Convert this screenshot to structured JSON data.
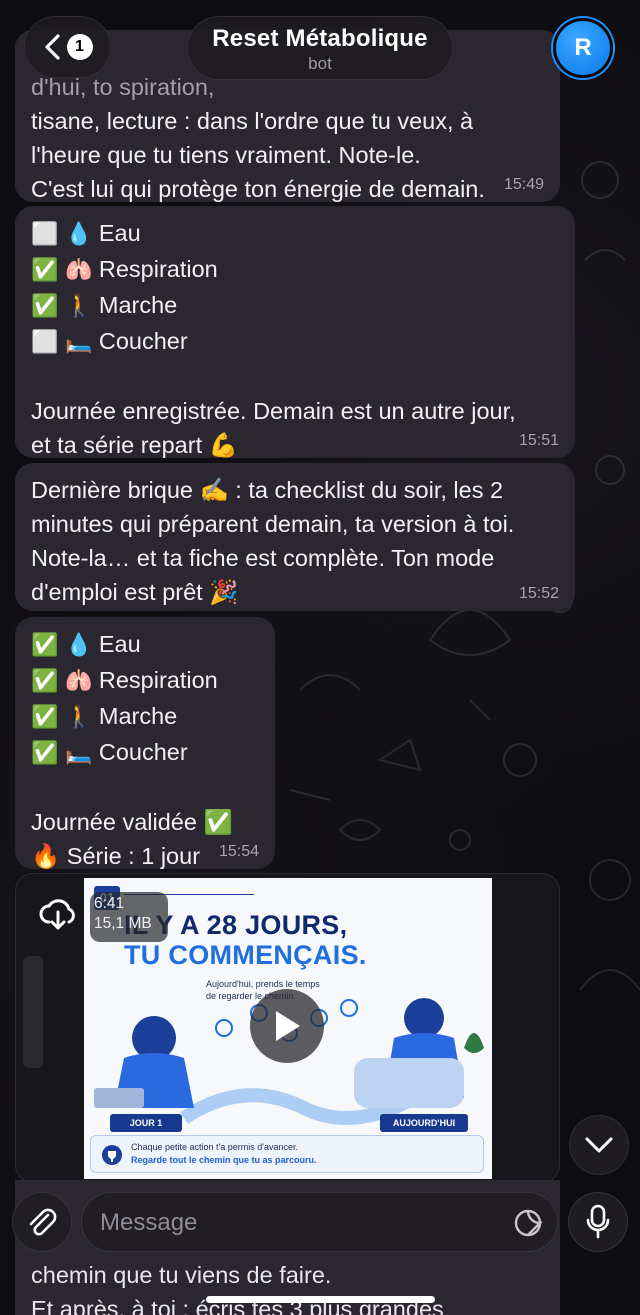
{
  "header": {
    "back_badge": "1",
    "title": "Reset Métabolique",
    "subtitle": "bot",
    "avatar_letter": "R"
  },
  "messages": {
    "m1": {
      "lines": [
        "d'hui, to                 spiration,",
        "tisane, lecture : dans l'ordre que tu veux, à",
        "l'heure que tu tiens vraiment. Note-le.",
        "C'est lui qui protège ton énergie de demain."
      ],
      "time": "15:49"
    },
    "m2": {
      "checklist": [
        {
          "check": "⬜",
          "icon": "💧",
          "label": "Eau"
        },
        {
          "check": "✅",
          "icon": "🫁",
          "label": "Respiration"
        },
        {
          "check": "✅",
          "icon": "🚶",
          "label": "Marche"
        },
        {
          "check": "⬜",
          "icon": "🛏️",
          "label": "Coucher"
        }
      ],
      "line1": "Journée enregistrée. Demain est un autre jour,",
      "line2": "et ta série repart 💪",
      "time": "15:51"
    },
    "m3": {
      "lines": [
        "Dernière brique ✍️ : ta checklist du soir, les 2",
        "minutes qui préparent demain, ta version à toi.",
        "Note-la… et ta fiche est complète. Ton mode",
        "d'emploi est prêt 🎉"
      ],
      "time": "15:52"
    },
    "m4": {
      "checklist": [
        {
          "check": "✅",
          "icon": "💧",
          "label": "Eau"
        },
        {
          "check": "✅",
          "icon": "🫁",
          "label": "Respiration"
        },
        {
          "check": "✅",
          "icon": "🚶",
          "label": "Marche"
        },
        {
          "check": "✅",
          "icon": "🛏️",
          "label": "Coucher"
        }
      ],
      "line1": "Journée validée ✅",
      "line2": "🔥 Série : 1 jour",
      "time": "15:54"
    }
  },
  "video": {
    "duration": "6:41",
    "size": "15,1 MB",
    "frame": {
      "number": "01",
      "title_line1": "IL Y A 28 JOURS,",
      "title_line2": "TU COMMENÇAIS.",
      "sub1": "Aujourd'hui, prends le temps",
      "sub2": "de regarder le chemin.",
      "day1": "JOUR 1",
      "today": "AUJOURD'HUI",
      "foot1": "Chaque petite action t'a permis d'avancer.",
      "foot2": "Regarde tout le chemin que tu as parcouru."
    }
  },
  "bottom": {
    "under_line1": "chemin que tu viens de faire.",
    "under_line2": "Et après, à toi : écris tes 3 plus grandes",
    "placeholder": "Message"
  }
}
